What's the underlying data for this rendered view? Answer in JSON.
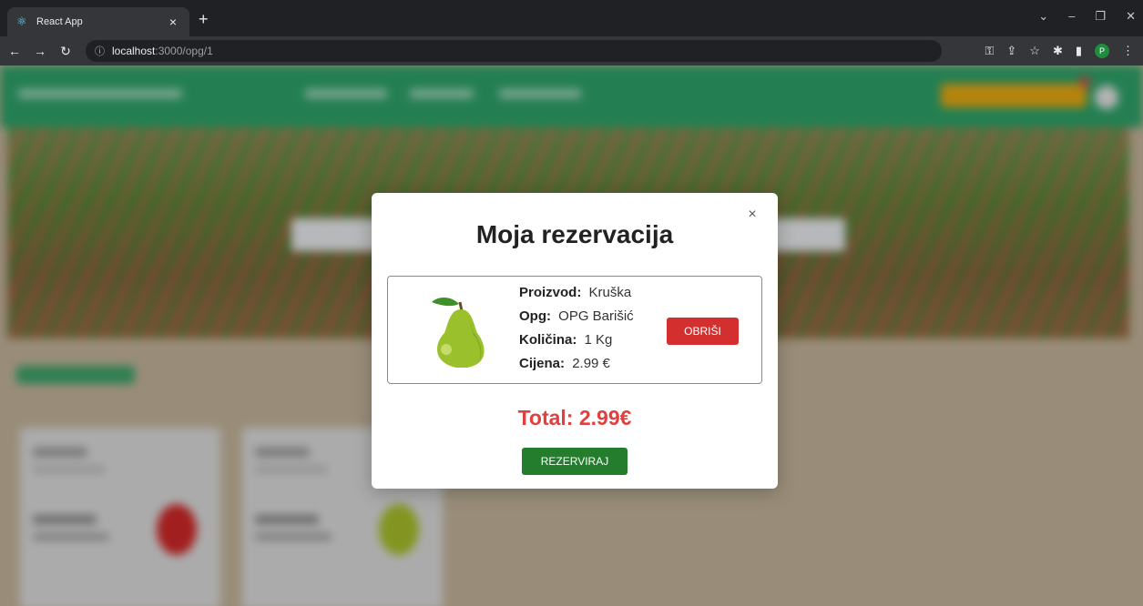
{
  "browser": {
    "tab_title": "React App",
    "url_host": "localhost",
    "url_path": ":3000/opg/1",
    "profile_initial": "P"
  },
  "modal": {
    "title": "Moja rezervacija",
    "close_label": "×",
    "item": {
      "product_label": "Proizvod:",
      "product_value": "Kruška",
      "opg_label": "Opg:",
      "opg_value": "OPG Barišić",
      "quantity_label": "Količina:",
      "quantity_value": "1 Kg",
      "price_label": "Cijena:",
      "price_value": "2.99 €",
      "image_icon": "pear-icon"
    },
    "delete_label": "OBRIŠI",
    "total": "Total: 2.99€",
    "reserve_label": "REZERVIRAJ"
  },
  "colors": {
    "site_nav": "#2ea36a",
    "delete": "#d32f2f",
    "reserve": "#237d2c",
    "total": "#e04040",
    "cta": "#e8a912"
  }
}
